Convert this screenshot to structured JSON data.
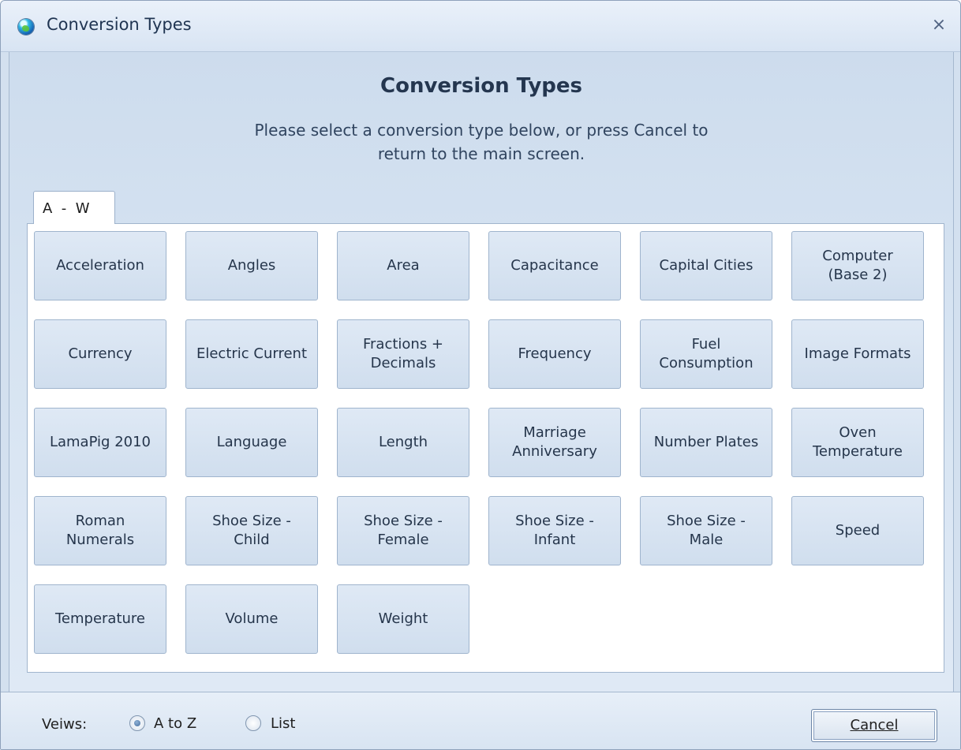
{
  "window": {
    "title": "Conversion Types",
    "icon": "globe-icon",
    "close_icon": "close-icon"
  },
  "header": {
    "heading": "Conversion Types",
    "instructions": "Please select a conversion type below, or press Cancel to\nreturn to the main screen."
  },
  "tabs": [
    {
      "label": "A  -  W",
      "selected": true
    }
  ],
  "conversion_types": [
    "Acceleration",
    "Angles",
    "Area",
    "Capacitance",
    "Capital Cities",
    "Computer\n(Base 2)",
    "Currency",
    "Electric Current",
    "Fractions +\nDecimals",
    "Frequency",
    "Fuel\nConsumption",
    "Image Formats",
    "LamaPig 2010",
    "Language",
    "Length",
    "Marriage\nAnniversary",
    "Number Plates",
    "Oven\nTemperature",
    "Roman\nNumerals",
    "Shoe Size -\nChild",
    "Shoe Size -\nFemale",
    "Shoe Size -\nInfant",
    "Shoe Size -\nMale",
    "Speed",
    "Temperature",
    "Volume",
    "Weight"
  ],
  "footer": {
    "views_label": "Veiws:",
    "view_options": [
      {
        "label": "A to Z",
        "selected": true
      },
      {
        "label": "List",
        "selected": false
      }
    ],
    "cancel_label": "Cancel"
  },
  "colors": {
    "window_background": "#d3e0ef",
    "button_background": "#d8e4f2",
    "button_border": "#9fb4cd",
    "text": "#25354b"
  }
}
